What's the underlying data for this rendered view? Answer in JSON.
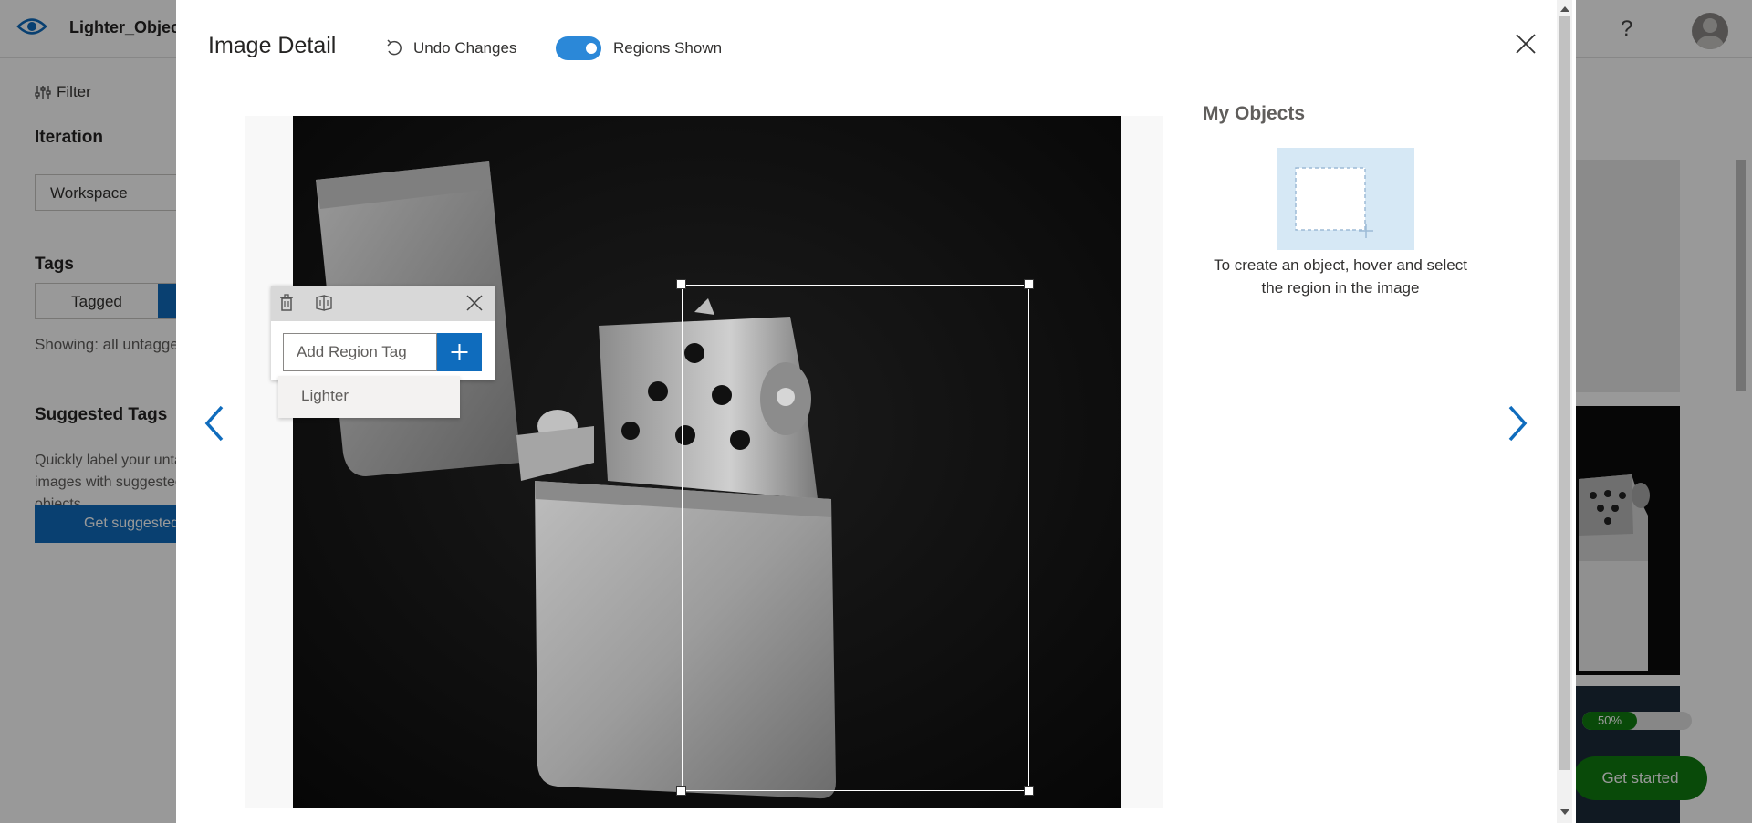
{
  "app": {
    "project_title": "Lighter_Objects",
    "filter_label": "Filter",
    "iteration_label": "Iteration",
    "iteration_value": "Workspace",
    "tags_label": "Tags",
    "tagged_tab": "Tagged",
    "showing_text": "Showing: all untagged",
    "suggested_tags_title": "Suggested Tags",
    "suggested_tags_desc": "Quickly label your untagged images with suggested objects",
    "get_suggested_button": "Get suggested objects",
    "help_icon": "question-icon",
    "progress_percent": 50,
    "progress_label": "50%",
    "get_started_button": "Get started"
  },
  "modal": {
    "title": "Image Detail",
    "undo_label": "Undo Changes",
    "regions_toggle_on": true,
    "regions_label": "Regions Shown",
    "close_icon": "close-icon",
    "prev_icon": "chevron-left-icon",
    "next_icon": "chevron-right-icon",
    "image_description": "Lighter photograph (black and white)",
    "region_popup": {
      "delete_icon": "trash-icon",
      "compare_icon": "compare-icon",
      "close_icon": "close-icon",
      "input_placeholder": "Add Region Tag",
      "input_value": "",
      "add_icon": "plus-icon",
      "suggestion": "Lighter"
    },
    "objects_panel": {
      "title": "My Objects",
      "hint": "To create an object, hover and select the region in the image"
    }
  },
  "colors": {
    "accent": "#0f6cbd",
    "toggle_on": "#2b88d8",
    "success": "#107c10",
    "objects_illustration": "#d6e8f5"
  }
}
